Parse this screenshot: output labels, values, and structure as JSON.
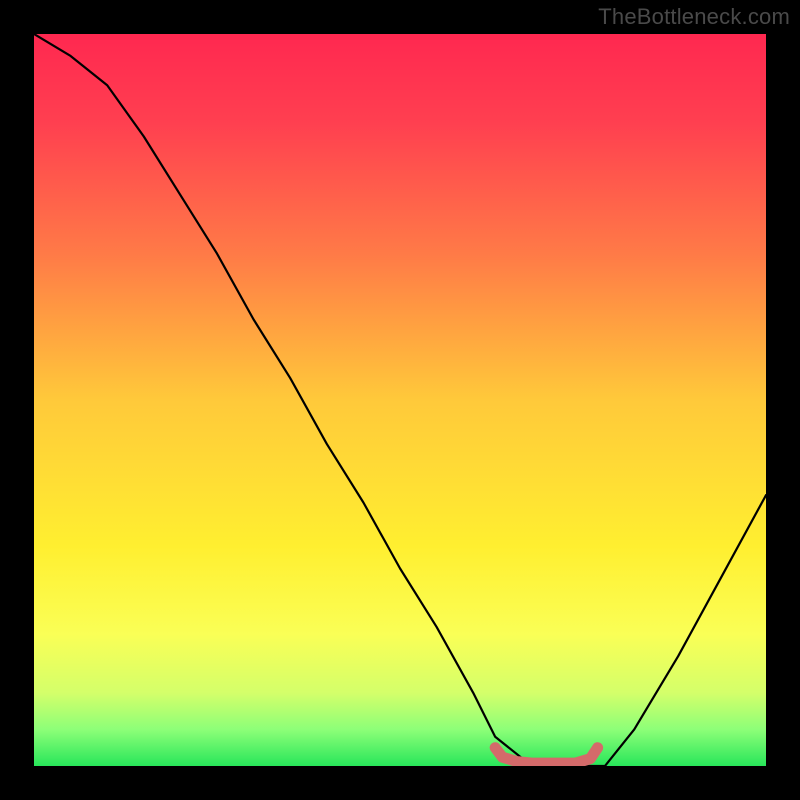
{
  "watermark": "TheBottleneck.com",
  "chart_data": {
    "type": "line",
    "title": "",
    "xlabel": "",
    "ylabel": "",
    "xlim": [
      0,
      100
    ],
    "ylim": [
      0,
      100
    ],
    "series": [
      {
        "name": "bottleneck-curve",
        "x": [
          0,
          5,
          10,
          15,
          20,
          25,
          30,
          35,
          40,
          45,
          50,
          55,
          60,
          63,
          68,
          74,
          78,
          82,
          88,
          94,
          100
        ],
        "values": [
          100,
          97,
          93,
          86,
          78,
          70,
          61,
          53,
          44,
          36,
          27,
          19,
          10,
          4,
          0,
          0,
          0,
          5,
          15,
          26,
          37
        ]
      }
    ],
    "highlight": {
      "name": "optimal-zone",
      "x": [
        63,
        64,
        66,
        68,
        70,
        72,
        74,
        76,
        77
      ],
      "values": [
        2.5,
        1.2,
        0.6,
        0.4,
        0.4,
        0.4,
        0.4,
        1.0,
        2.5
      ]
    },
    "gradient_stops": [
      {
        "offset": 0.0,
        "color": "#ff2850"
      },
      {
        "offset": 0.12,
        "color": "#ff3f50"
      },
      {
        "offset": 0.3,
        "color": "#ff7a47"
      },
      {
        "offset": 0.5,
        "color": "#ffc93a"
      },
      {
        "offset": 0.7,
        "color": "#ffef30"
      },
      {
        "offset": 0.82,
        "color": "#faff56"
      },
      {
        "offset": 0.9,
        "color": "#d4ff6a"
      },
      {
        "offset": 0.95,
        "color": "#8dff78"
      },
      {
        "offset": 1.0,
        "color": "#28e65a"
      }
    ]
  }
}
